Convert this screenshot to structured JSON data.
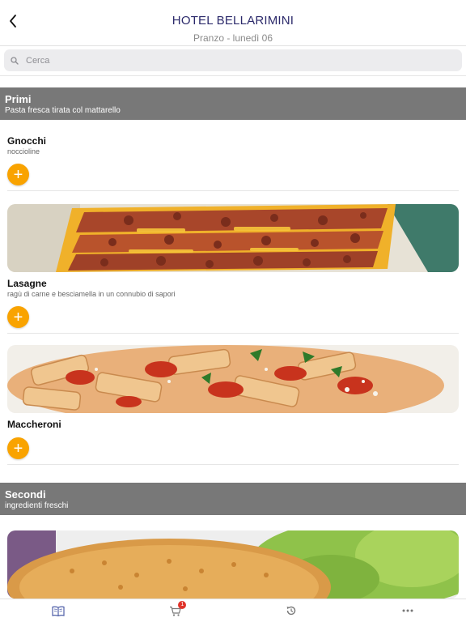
{
  "header": {
    "title": "HOTEL BELLARIMINI",
    "subtitle": "Pranzo - lunedì 06"
  },
  "search": {
    "placeholder": "Cerca"
  },
  "sections": [
    {
      "name": "Primi",
      "description": "Pasta fresca tirata col mattarello",
      "items": [
        {
          "name": "Gnocchi",
          "description": "noccioline"
        },
        {
          "name": "Lasagne",
          "description": "ragù di carne e besciamella in un connubio di sapori",
          "photo": "lasagne-photo"
        },
        {
          "name": "Maccheroni",
          "description": "",
          "photo": "maccheroni-photo"
        }
      ]
    },
    {
      "name": "Secondi",
      "description": "ingredienti freschi",
      "items": [
        {
          "photo": "cutlet-photo"
        }
      ]
    }
  ],
  "tabbar": {
    "tabs": [
      {
        "icon": "menu-book-icon"
      },
      {
        "icon": "cart-icon",
        "badge": "1"
      },
      {
        "icon": "history-icon"
      },
      {
        "icon": "more-icon"
      }
    ]
  },
  "colors": {
    "accent": "#f9a300",
    "section_bar": "#787878",
    "title": "#2c2a6b",
    "tab_icon": "#4f5fa8",
    "badge": "#e0342b"
  }
}
